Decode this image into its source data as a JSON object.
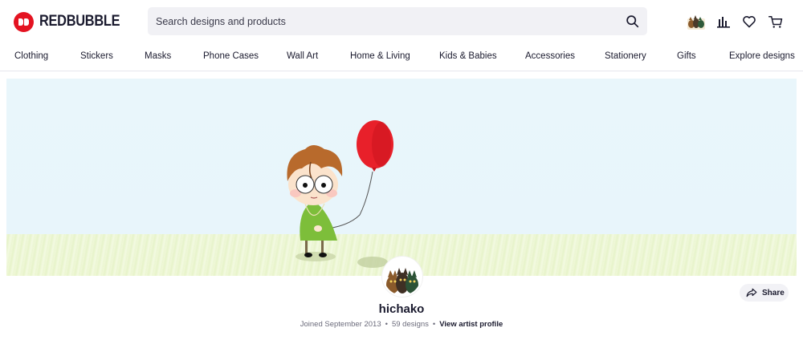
{
  "header": {
    "logo_text": "REDBUBBLE",
    "search": {
      "placeholder": "Search designs and products"
    },
    "icons": [
      "avatar-thumb",
      "stats-icon",
      "heart-icon",
      "cart-icon"
    ]
  },
  "nav": {
    "items": [
      {
        "label": "Clothing"
      },
      {
        "label": "Stickers"
      },
      {
        "label": "Masks"
      },
      {
        "label": "Phone Cases"
      },
      {
        "label": "Wall Art"
      },
      {
        "label": "Home & Living"
      },
      {
        "label": "Kids & Babies"
      },
      {
        "label": "Accessories"
      },
      {
        "label": "Stationery"
      },
      {
        "label": "Gifts"
      },
      {
        "label": "Explore designs"
      }
    ]
  },
  "profile": {
    "name": "hichako",
    "joined": "Joined September 2013",
    "designs": "59 designs",
    "view_profile": "View artist profile",
    "share_label": "Share"
  },
  "colors": {
    "brand": "#e41321",
    "banner_sky": "#e9f6fb",
    "balloon": "#e8202a",
    "shirt": "#7dbe3a",
    "hair": "#b86a2c"
  }
}
